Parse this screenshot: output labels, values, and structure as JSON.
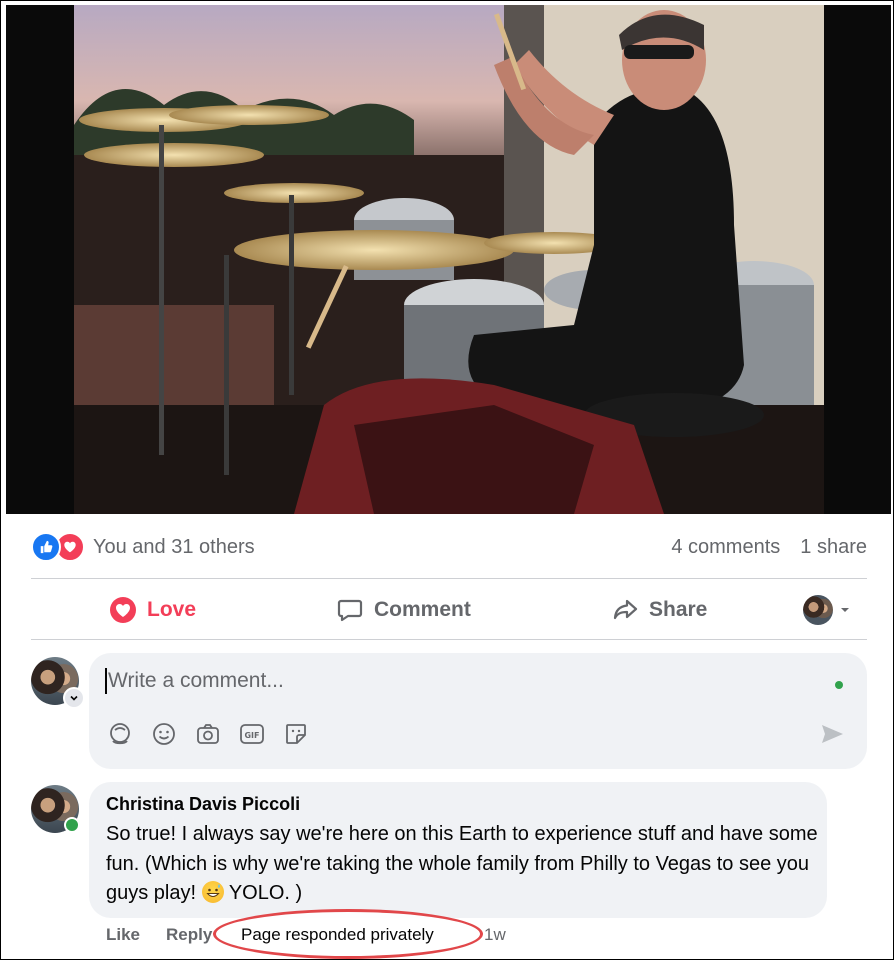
{
  "post": {
    "photo_alt": "Drummer performing on stage behind a large drum kit",
    "reactions": {
      "summary": "You and 31 others",
      "icons": [
        "like-icon",
        "love-icon"
      ]
    },
    "comments_count": "4 comments",
    "shares_count": "1 share"
  },
  "actions": {
    "love": "Love",
    "comment": "Comment",
    "share": "Share"
  },
  "composer": {
    "placeholder": "Write a comment...",
    "tools": [
      "avatar-sticker-icon",
      "emoji-icon",
      "camera-icon",
      "gif-icon",
      "sticker-icon"
    ],
    "send_icon": "send-icon"
  },
  "comments": [
    {
      "author": "Christina Davis Piccoli",
      "text_before_emoji": "So true! I always say we're here on this Earth to experience stuff and have some fun. (Which is why we're taking the whole family from Philly to Vegas to see you guys play!",
      "emoji": "grinning-sweat-emoji",
      "text_after_emoji": "YOLO. )",
      "like_label": "Like",
      "reply_label": "Reply",
      "page_note": "Page responded privately",
      "time": "1w"
    }
  ],
  "colors": {
    "love_red": "#f33e58",
    "like_blue": "#1877f2",
    "online_green": "#31a24c",
    "annotation_red": "#e1474a"
  }
}
